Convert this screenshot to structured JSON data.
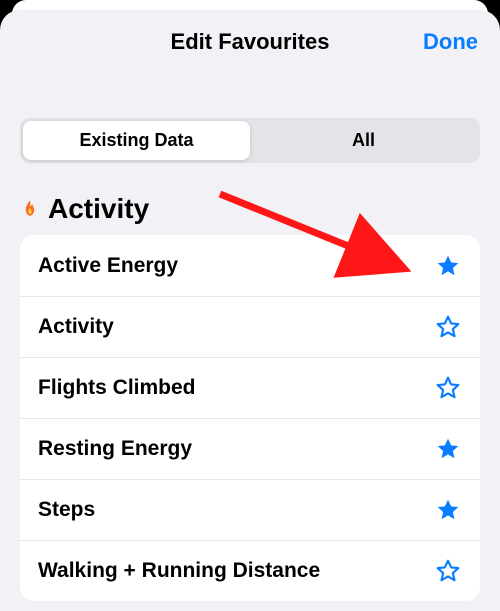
{
  "header": {
    "title": "Edit Favourites",
    "done": "Done"
  },
  "tabs": {
    "existing": "Existing Data",
    "all": "All",
    "selected": "existing"
  },
  "section": {
    "title": "Activity",
    "icon": "flame"
  },
  "rows": [
    {
      "label": "Active Energy",
      "fav": true
    },
    {
      "label": "Activity",
      "fav": false
    },
    {
      "label": "Flights Climbed",
      "fav": false
    },
    {
      "label": "Resting Energy",
      "fav": true
    },
    {
      "label": "Steps",
      "fav": true
    },
    {
      "label": "Walking + Running Distance",
      "fav": false
    }
  ],
  "colors": {
    "accent": "#0a7cff",
    "flame": "#ff3c1f",
    "annotation": "#ff1616"
  }
}
